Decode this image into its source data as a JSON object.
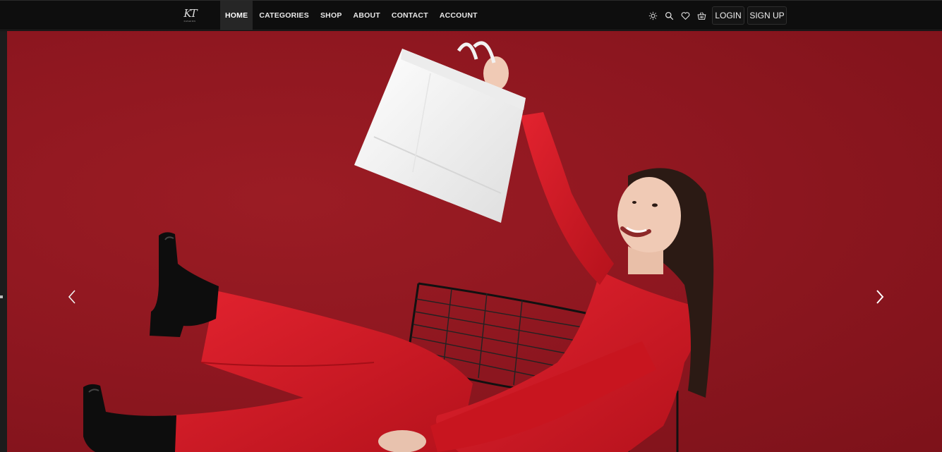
{
  "brand": {
    "logo_text": "KT",
    "logo_subtext": "FASHION"
  },
  "nav": {
    "links": [
      {
        "label": "HOME",
        "active": true
      },
      {
        "label": "CATEGORIES",
        "active": false
      },
      {
        "label": "SHOP",
        "active": false
      },
      {
        "label": "ABOUT",
        "active": false
      },
      {
        "label": "CONTACT",
        "active": false
      },
      {
        "label": "ACCOUNT",
        "active": false
      }
    ],
    "icons": [
      "sun-icon",
      "search-icon",
      "heart-icon",
      "basket-icon"
    ],
    "login_label": "LOGIN",
    "signup_label": "SIGN UP"
  },
  "hero": {
    "image_subject": "woman-in-red-with-shopping-bag",
    "background_color": "#8f1720"
  },
  "colors": {
    "navbar_bg": "#0e0e0e",
    "accent_red": "#8f1720",
    "text": "#e8e8e8"
  }
}
